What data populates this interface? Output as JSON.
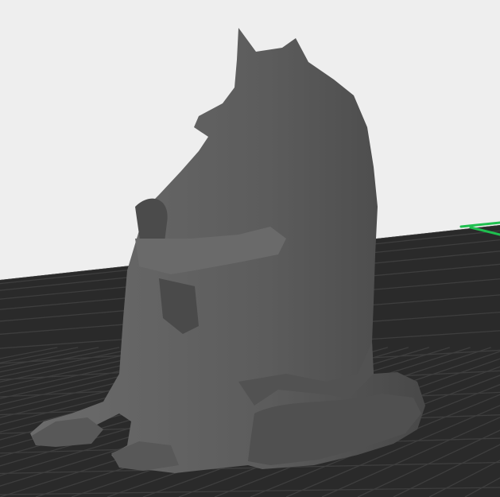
{
  "viewport": {
    "background_color": "#eeeeee",
    "plate_color": "#2a2a2a",
    "grid_line_color": "#3e3e3e",
    "model_color": "#5f5f5f",
    "model_shadow_color": "#454545",
    "axis_color": "#1fbf4f",
    "axis_icon": "y-axis-arrow-icon"
  }
}
